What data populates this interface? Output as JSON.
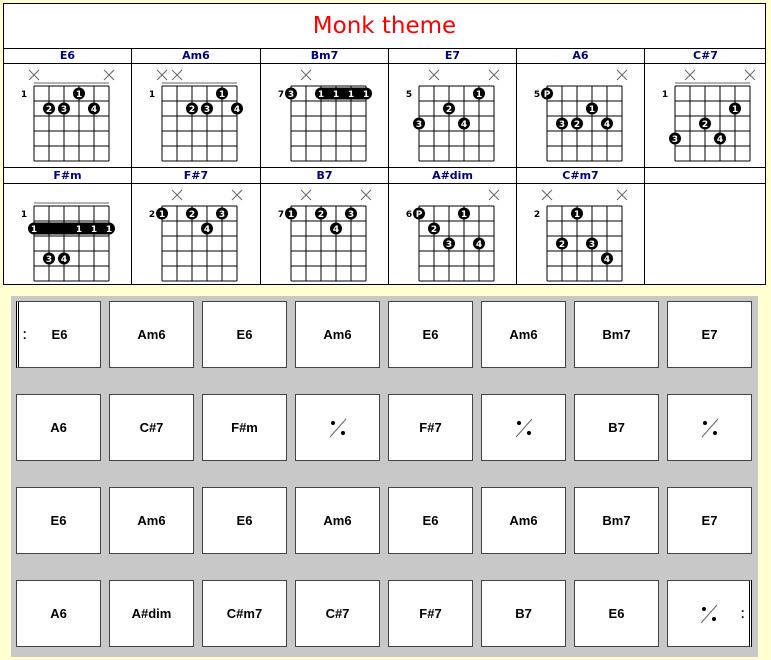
{
  "title": "Monk theme",
  "colors": {
    "title": "#FF0000",
    "chord_name": "#000080",
    "background": "#FFFFD2",
    "grid_bg": "#C8C8C8"
  },
  "chords": [
    {
      "name": "E6",
      "fret": "1",
      "nut": true,
      "muted": [
        1,
        6
      ],
      "dots": [
        [
          4,
          1,
          "1"
        ],
        [
          2,
          2,
          "2"
        ],
        [
          3,
          2,
          "3"
        ],
        [
          5,
          2,
          "4"
        ]
      ],
      "barre": null
    },
    {
      "name": "Am6",
      "fret": "1",
      "nut": true,
      "muted": [
        1,
        2
      ],
      "dots": [
        [
          5,
          1,
          "1"
        ],
        [
          3,
          2,
          "2"
        ],
        [
          4,
          2,
          "3"
        ],
        [
          6,
          2,
          "4"
        ]
      ],
      "barre": null
    },
    {
      "name": "Bm7",
      "fret": "7",
      "nut": false,
      "muted": [
        2
      ],
      "dots": [
        [
          1,
          1,
          "3"
        ]
      ],
      "barre": {
        "from": 3,
        "to": 6,
        "fret": 1,
        "labels": [
          "1",
          "1",
          "1",
          "1"
        ]
      }
    },
    {
      "name": "E7",
      "fret": "5",
      "nut": false,
      "muted": [
        2,
        6
      ],
      "dots": [
        [
          5,
          1,
          "1"
        ],
        [
          3,
          2,
          "2"
        ],
        [
          1,
          3,
          "3"
        ],
        [
          4,
          3,
          "4"
        ]
      ],
      "barre": null
    },
    {
      "name": "A6",
      "fret": "5",
      "nut": false,
      "muted": [
        6
      ],
      "dots": [
        [
          1,
          1,
          "P"
        ],
        [
          4,
          2,
          "1"
        ],
        [
          2,
          3,
          "3"
        ],
        [
          3,
          3,
          "2"
        ],
        [
          5,
          3,
          "4"
        ]
      ],
      "barre": null
    },
    {
      "name": "C#7",
      "fret": "1",
      "nut": true,
      "muted": [
        2,
        6
      ],
      "dots": [
        [
          5,
          2,
          "1"
        ],
        [
          3,
          3,
          "2"
        ],
        [
          1,
          4,
          "3"
        ],
        [
          4,
          4,
          "4"
        ]
      ],
      "barre": null
    },
    {
      "name": "F#m",
      "fret": "1",
      "nut": true,
      "muted": [],
      "dots": [
        [
          2,
          4,
          "3"
        ],
        [
          3,
          4,
          "4"
        ]
      ],
      "barre": {
        "from": 1,
        "to": 6,
        "fret": 2,
        "labels": [
          "1",
          "",
          "",
          "1",
          "1",
          "1"
        ]
      }
    },
    {
      "name": "F#7",
      "fret": "2",
      "nut": false,
      "muted": [
        2,
        6
      ],
      "dots": [
        [
          1,
          1,
          "1"
        ],
        [
          3,
          1,
          "2"
        ],
        [
          5,
          1,
          "3"
        ],
        [
          4,
          2,
          "4"
        ]
      ],
      "barre": null
    },
    {
      "name": "B7",
      "fret": "7",
      "nut": false,
      "muted": [
        2,
        6
      ],
      "dots": [
        [
          1,
          1,
          "1"
        ],
        [
          3,
          1,
          "2"
        ],
        [
          5,
          1,
          "3"
        ],
        [
          4,
          2,
          "4"
        ]
      ],
      "barre": null
    },
    {
      "name": "A#dim",
      "fret": "6",
      "nut": false,
      "muted": [
        6
      ],
      "dots": [
        [
          1,
          1,
          "P"
        ],
        [
          4,
          1,
          "1"
        ],
        [
          2,
          2,
          "2"
        ],
        [
          3,
          3,
          "3"
        ],
        [
          5,
          3,
          "4"
        ]
      ],
      "barre": null
    },
    {
      "name": "C#m7",
      "fret": "2",
      "nut": false,
      "muted": [
        1,
        6
      ],
      "dots": [
        [
          3,
          1,
          "1"
        ],
        [
          2,
          3,
          "2"
        ],
        [
          4,
          3,
          "3"
        ],
        [
          5,
          4,
          "4"
        ]
      ],
      "barre": null
    }
  ],
  "bars": [
    [
      "E6",
      "Am6",
      "E6",
      "Am6",
      "E6",
      "Am6",
      "Bm7",
      "E7"
    ],
    [
      "A6",
      "C#7",
      "F#m",
      "%",
      "F#7",
      "%",
      "B7",
      "%"
    ],
    [
      "E6",
      "Am6",
      "E6",
      "Am6",
      "E6",
      "Am6",
      "Bm7",
      "E7"
    ],
    [
      "A6",
      "A#dim",
      "C#m7",
      "C#7",
      "F#7",
      "B7",
      "E6",
      "%"
    ]
  ]
}
